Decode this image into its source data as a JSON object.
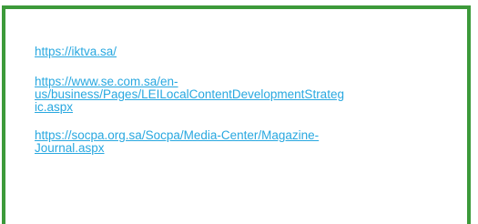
{
  "links": [
    "https://iktva.sa/",
    "https://www.se.com.sa/en-us/business/Pages/LEILocalContentDevelopmentStrategic.aspx",
    "https://socpa.org.sa/Socpa/Media-Center/Magazine-Journal.aspx"
  ],
  "colors": {
    "border": "#3c9a3a",
    "link": "#29a8e0"
  }
}
